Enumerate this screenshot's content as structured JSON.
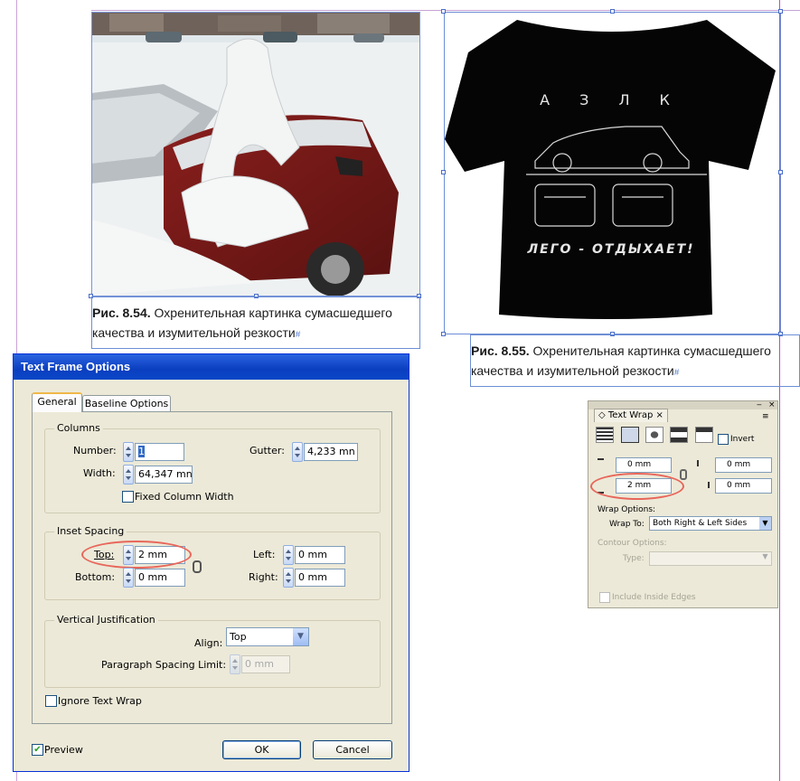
{
  "captions": {
    "left": {
      "prefix": "Рис. 8.54.",
      "line1": " Охренительная картинка сумасшедшего",
      "line2": "качества и изумительной резкости"
    },
    "right": {
      "prefix": "Рис. 8.55.",
      "line1": " Охренительная картинка сумасшедшего",
      "line2": "качества и изумительной резкости"
    },
    "pilcrow": "#"
  },
  "tshirt": {
    "top_text": "А З Л К",
    "bottom_text": "ЛЕГО - ОТДЫХАЕТ!"
  },
  "dialog": {
    "title": "Text Frame Options",
    "tabs": [
      "General",
      "Baseline Options"
    ],
    "columns": {
      "label": "Columns",
      "number_label": "Number:",
      "number_value": "1",
      "gutter_label": "Gutter:",
      "gutter_value": "4,233 mn",
      "width_label": "Width:",
      "width_value": "64,347 mn",
      "fixed_label": "Fixed Column Width"
    },
    "inset": {
      "label": "Inset Spacing",
      "top_label": "Top:",
      "top_value": "2 mm",
      "bottom_label": "Bottom:",
      "bottom_value": "0 mm",
      "left_label": "Left:",
      "left_value": "0 mm",
      "right_label": "Right:",
      "right_value": "0 mm"
    },
    "vj": {
      "label": "Vertical Justification",
      "align_label": "Align:",
      "align_value": "Top",
      "psl_label": "Paragraph Spacing Limit:",
      "psl_value": "0 mm"
    },
    "ignore_wrap_label": "Ignore Text Wrap",
    "preview_label": "Preview",
    "preview_checked": true,
    "ok_label": "OK",
    "cancel_label": "Cancel"
  },
  "textwrap": {
    "tab_label": "Text Wrap",
    "invert_label": "Invert",
    "top_offset": "0 mm",
    "bottom_offset": "2 mm",
    "left_offset": "0 mm",
    "right_offset": "0 mm",
    "wrap_options_label": "Wrap Options:",
    "wrap_to_label": "Wrap To:",
    "wrap_to_value": "Both Right & Left Sides",
    "contour_label": "Contour Options:",
    "type_label": "Type:",
    "include_label": "Include Inside Edges"
  },
  "colors": {
    "accent_blue": "#0a3fc0",
    "guide_magenta": "#b04fc8",
    "frame_blue": "#6d8fd6",
    "annotation_red": "#e8665a"
  }
}
